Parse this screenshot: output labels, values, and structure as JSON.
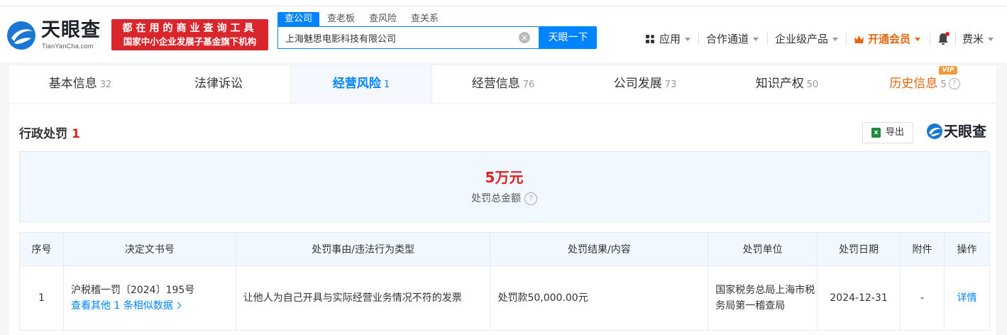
{
  "header": {
    "logo_text": "天眼查",
    "logo_sub": "TianYanCha.com",
    "slogan_line1": "都在用的商业查询工具",
    "slogan_line2": "国家中小企业发展子基金旗下机构",
    "search_tabs": [
      "查公司",
      "查老板",
      "查风险",
      "查关系"
    ],
    "search_value": "上海魅思电影科技有限公司",
    "clear_glyph": "×",
    "search_button": "天眼一下",
    "nav": {
      "apps": "应用",
      "partners": "合作通道",
      "enterprise": "企业级产品",
      "vip": "开通会员",
      "user": "费米"
    }
  },
  "tabs": [
    {
      "label": "基本信息",
      "count": "32"
    },
    {
      "label": "法律诉讼",
      "count": ""
    },
    {
      "label": "经营风险",
      "count": "1"
    },
    {
      "label": "经营信息",
      "count": "76"
    },
    {
      "label": "公司发展",
      "count": "73"
    },
    {
      "label": "知识产权",
      "count": "50"
    },
    {
      "label": "历史信息",
      "count": "5"
    }
  ],
  "vip_badge": "VIP",
  "section": {
    "title": "行政处罚",
    "count": "1",
    "export_label": "导出",
    "export_icon_glyph": "x",
    "brand": "天眼查",
    "help_glyph": "?"
  },
  "summary": {
    "amount": "5万元",
    "label": "处罚总金额"
  },
  "table": {
    "headers": [
      "序号",
      "决定文书号",
      "处罚事由/违法行为类型",
      "处罚结果/内容",
      "处罚单位",
      "处罚日期",
      "附件",
      "操作"
    ],
    "rows": [
      {
        "index": "1",
        "doc_no": "沪税稽一罚〔2024〕195号",
        "similar_link": "查看其他 1 条相似数据",
        "reason": "让他人为自己开具与实际经营业务情况不符的发票",
        "result": "处罚款50,000.00元",
        "authority": "国家税务总局上海市税务局第一稽查局",
        "date": "2024-12-31",
        "attachment": "-",
        "action": "详情"
      }
    ]
  },
  "colors": {
    "accent": "#0084ff",
    "danger": "#e02020",
    "vip": "#e4660e"
  }
}
